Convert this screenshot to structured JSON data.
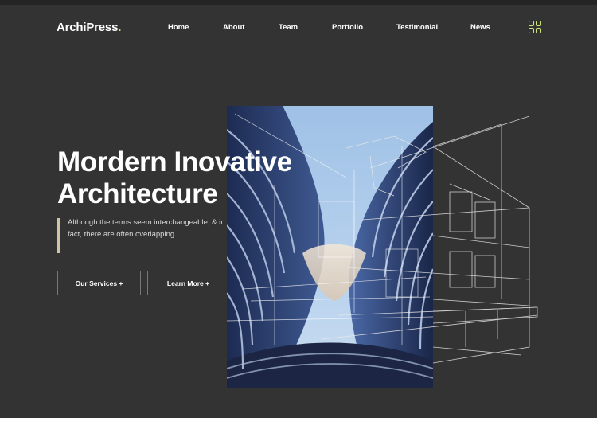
{
  "brand": {
    "name": "ArchiPress",
    "dot": "."
  },
  "nav": {
    "items": [
      "Home",
      "About",
      "Team",
      "Portfolio",
      "Testimonial",
      "News"
    ]
  },
  "hero": {
    "title_line1": "Mordern Inovative",
    "title_line2": "Architecture",
    "description": "Although the terms seem interchangeable, & in fact, there are often overlapping.",
    "primary_button": "Our Services +",
    "secondary_button": "Learn More +"
  },
  "icons": {
    "menu": "grid-menu-icon",
    "hero_image": "modern-building-photo",
    "hero_sketch": "building-line-sketch"
  },
  "colors": {
    "background": "#333333",
    "accent": "#c9e27a",
    "text": "#ffffff",
    "quote_bar": "#cfc4a4"
  }
}
